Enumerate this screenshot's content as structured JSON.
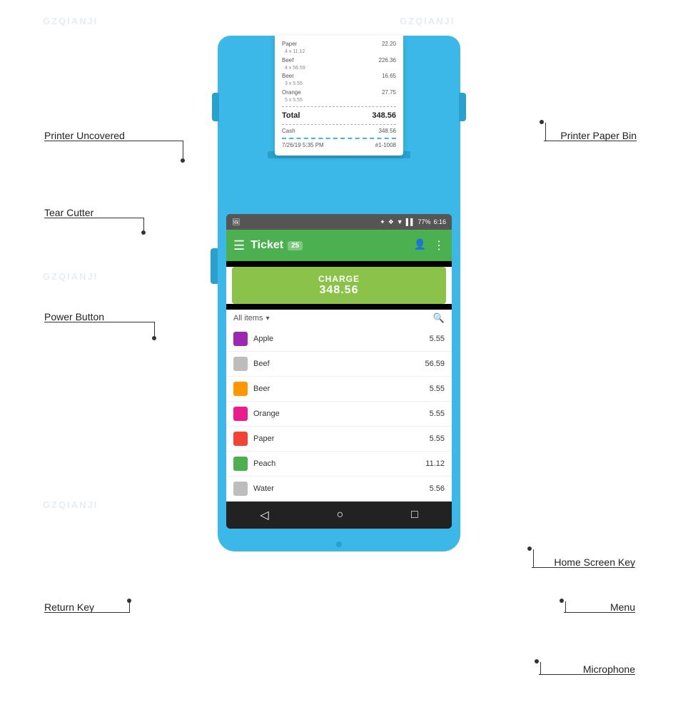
{
  "watermarks": [
    "GZQIANJI",
    "GZQIANJI",
    "GZQIANJI",
    "GZQIANJI",
    "GZQIANJI",
    "GZQIANJI"
  ],
  "labels": {
    "printer_uncovered": "Printer Uncovered",
    "printer_paper_bin": "Printer Paper Bin",
    "tear_cutter": "Tear Cutter",
    "power_button": "Power Button",
    "home_screen_key": "Home Screen Key",
    "return_key": "Return Key",
    "menu": "Menu",
    "microphone": "Microphone"
  },
  "receipt": {
    "lines": [
      {
        "name": "Paper",
        "qty_price": "4 x 11.12",
        "total": "22.20"
      },
      {
        "name": "Beef",
        "qty_price": "4 x 56.59",
        "total": "226.36"
      },
      {
        "name": "Beer",
        "qty_price": "3 x 5.55",
        "total": "16.65"
      },
      {
        "name": "Orange",
        "qty_price": "5 x 5.55",
        "total": "27.75"
      }
    ],
    "total_label": "Total",
    "total_value": "348.56",
    "cash_label": "Cash",
    "cash_value": "348.56",
    "datetime": "7/26/19 5:35 PM",
    "order_id": "#1-1008"
  },
  "status_bar": {
    "battery": "77%",
    "time": "6:16",
    "icons": "✦ ❖ ▼ ▌▌"
  },
  "app_bar": {
    "menu_icon": "☰",
    "title": "Ticket",
    "badge": "25",
    "add_person_icon": "👤+",
    "more_icon": "⋮"
  },
  "charge": {
    "label": "CHARGE",
    "amount": "348.56"
  },
  "filter": {
    "label": "All items",
    "dropdown_icon": "▾",
    "search_icon": "🔍"
  },
  "items": [
    {
      "name": "Apple",
      "price": "5.55",
      "color": "#9c27b0"
    },
    {
      "name": "Beef",
      "price": "56.59",
      "color": "#bdbdbd"
    },
    {
      "name": "Beer",
      "price": "5.55",
      "color": "#ff9800"
    },
    {
      "name": "Orange",
      "price": "5.55",
      "color": "#e91e8c"
    },
    {
      "name": "Paper",
      "price": "5.55",
      "color": "#f44336"
    },
    {
      "name": "Peach",
      "price": "11.12",
      "color": "#4caf50"
    },
    {
      "name": "Water",
      "price": "5.56",
      "color": "#bdbdbd"
    }
  ],
  "nav": {
    "back_icon": "◁",
    "home_icon": "○",
    "recents_icon": "□"
  }
}
